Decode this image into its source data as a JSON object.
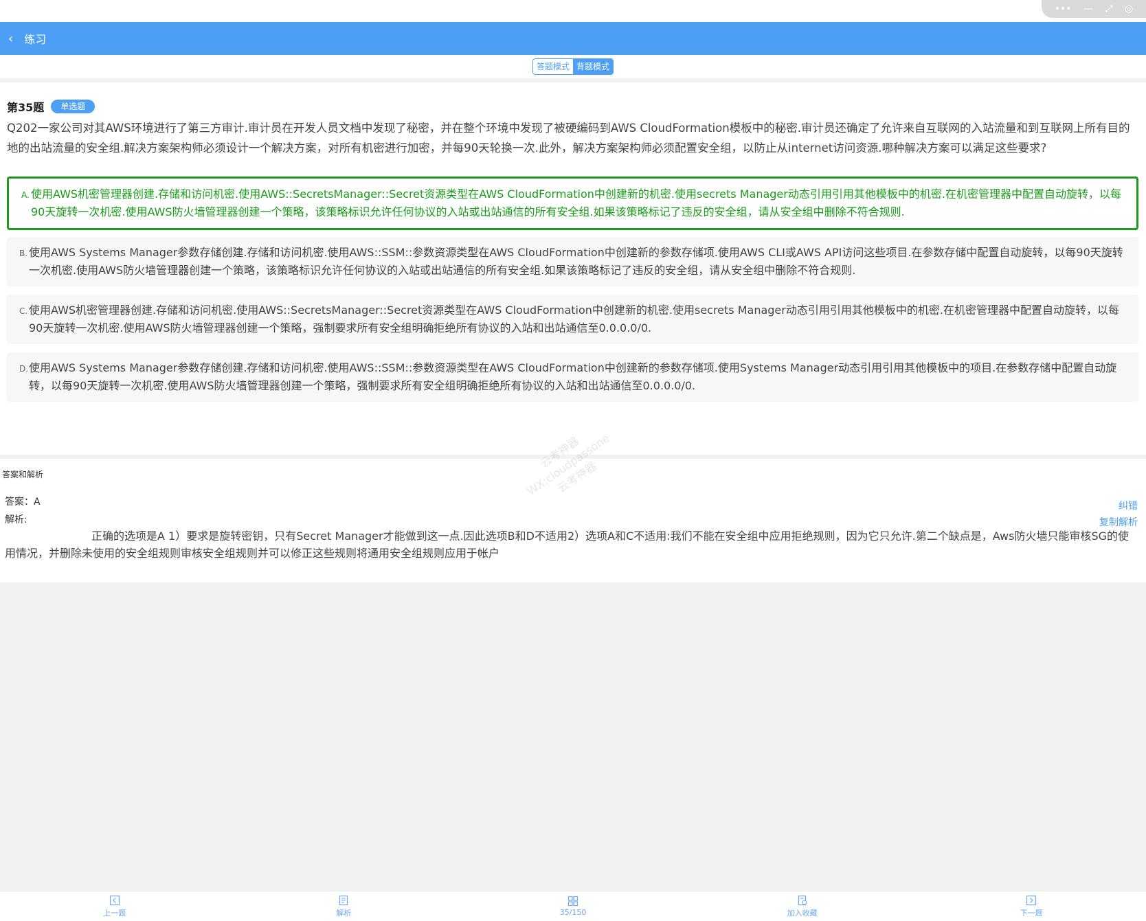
{
  "window_controls": [
    "•••",
    "—",
    "⤢",
    "◎"
  ],
  "navbar": {
    "back_icon": "‹",
    "title": "练习"
  },
  "mode_switch": {
    "answer_mode": "答题模式",
    "recite_mode": "背题模式"
  },
  "question": {
    "number_label": "第35题",
    "type_badge": "单选题",
    "text": "Q202一家公司对其AWS环境进行了第三方审计.审计员在开发人员文档中发现了秘密，并在整个环境中发现了被硬编码到AWS CloudFormation模板中的秘密.审计员还确定了允许来自互联网的入站流量和到互联网上所有目的地的出站流量的安全组.解决方案架构师必须设计一个解决方案，对所有机密进行加密，并每90天轮换一次.此外，解决方案架构师必须配置安全组，以防止从internet访问资源.哪种解决方案可以满足这些要求?"
  },
  "options": [
    {
      "letter": "A.",
      "text": "使用AWS机密管理器创建.存储和访问机密.使用AWS::SecretsManager::Secret资源类型在AWS CloudFormation中创建新的机密.使用secrets Manager动态引用引用其他模板中的机密.在机密管理器中配置自动旋转，以每90天旋转一次机密.使用AWS防火墙管理器创建一个策略，该策略标识允许任何协议的入站或出站通信的所有安全组.如果该策略标记了违反的安全组，请从安全组中删除不符合规则.",
      "correct": true
    },
    {
      "letter": "B.",
      "text": "使用AWS Systems Manager参数存储创建.存储和访问机密.使用AWS::SSM::参数资源类型在AWS CloudFormation中创建新的参数存储项.使用AWS CLI或AWS API访问这些项目.在参数存储中配置自动旋转，以每90天旋转一次机密.使用AWS防火墙管理器创建一个策略，该策略标识允许任何协议的入站或出站通信的所有安全组.如果该策略标记了违反的安全组，请从安全组中删除不符合规则.",
      "correct": false
    },
    {
      "letter": "C.",
      "text": "使用AWS机密管理器创建.存储和访问机密.使用AWS::SecretsManager::Secret资源类型在AWS CloudFormation中创建新的机密.使用secrets Manager动态引用引用其他模板中的机密.在机密管理器中配置自动旋转，以每90天旋转一次机密.使用AWS防火墙管理器创建一个策略，强制要求所有安全组明确拒绝所有协议的入站和出站通信至0.0.0.0/0.",
      "correct": false
    },
    {
      "letter": "D.",
      "text": "使用AWS Systems Manager参数存储创建.存储和访问机密.使用AWS::SSM::参数资源类型在AWS CloudFormation中创建新的参数存储项.使用Systems Manager动态引用引用其他模板中的项目.在参数存储中配置自动旋转，以每90天旋转一次机密.使用AWS防火墙管理器创建一个策略，强制要求所有安全组明确拒绝所有协议的入站和出站通信至0.0.0.0/0.",
      "correct": false
    }
  ],
  "answer_section": {
    "title": "答案和解析",
    "answer_label": "答案：A",
    "analysis_label": "解析:",
    "analysis_text": "正确的选项是A 1）要求是旋转密钥，只有Secret Manager才能做到这一点.因此选项B和D不适用2）选项A和C不适用:我们不能在安全组中应用拒绝规则，因为它只允许.第二个缺点是，Aws防火墙只能审核SG的使用情况，并删除未使用的安全组规则审核安全组规则并可以修正这些规则将通用安全组规则应用于帐户",
    "report_error": "纠错",
    "copy_analysis": "复制解析"
  },
  "watermark": [
    "云考神器",
    "WX:cloudpassone",
    "云考神器"
  ],
  "tabbar": [
    {
      "icon": "prev-icon",
      "label": "上一题"
    },
    {
      "icon": "analysis-icon",
      "label": "解析"
    },
    {
      "icon": "grid-icon",
      "label": "35/150"
    },
    {
      "icon": "favorite-icon",
      "label": "加入收藏"
    },
    {
      "icon": "next-icon",
      "label": "下一题"
    }
  ]
}
